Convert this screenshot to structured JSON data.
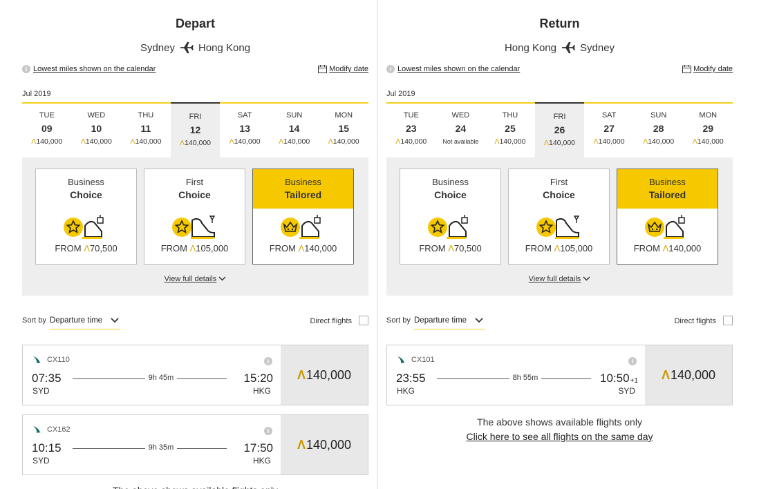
{
  "depart": {
    "title": "Depart",
    "from": "Sydney",
    "to": "Hong Kong",
    "lowest_miles_link": "Lowest miles shown on the calendar",
    "modify_date": "Modify date",
    "month": "Jul 2019",
    "dates": [
      {
        "dow": "TUE",
        "day": "09",
        "miles": "140,000"
      },
      {
        "dow": "WED",
        "day": "10",
        "miles": "140,000"
      },
      {
        "dow": "THU",
        "day": "11",
        "miles": "140,000"
      },
      {
        "dow": "FRI",
        "day": "12",
        "miles": "140,000",
        "selected": true
      },
      {
        "dow": "SAT",
        "day": "13",
        "miles": "140,000"
      },
      {
        "dow": "SUN",
        "day": "14",
        "miles": "140,000"
      },
      {
        "dow": "MON",
        "day": "15",
        "miles": "140,000"
      }
    ],
    "cabins": [
      {
        "name": "Business",
        "type": "Choice",
        "from_label": "FROM",
        "miles": "70,500",
        "icon": "star-seat-icon"
      },
      {
        "name": "First",
        "type": "Choice",
        "from_label": "FROM",
        "miles": "105,000",
        "icon": "star-first-seat-icon"
      },
      {
        "name": "Business",
        "type": "Tailored",
        "from_label": "FROM",
        "miles": "140,000",
        "icon": "crown-seat-icon",
        "selected": true
      }
    ],
    "view_details": "View full details",
    "sort_label": "Sort by",
    "sort_value": "Departure time",
    "direct_flights": "Direct flights",
    "flights": [
      {
        "code": "CX110",
        "dep_time": "07:35",
        "dep_ap": "SYD",
        "duration": "9h 45m",
        "arr_time": "15:20",
        "arr_suffix": "",
        "arr_ap": "HKG",
        "price": "140,000"
      },
      {
        "code": "CX162",
        "dep_time": "10:15",
        "dep_ap": "SYD",
        "duration": "9h 35m",
        "arr_time": "17:50",
        "arr_suffix": "",
        "arr_ap": "HKG",
        "price": "140,000"
      }
    ],
    "note": "The above shows available flights only"
  },
  "return": {
    "title": "Return",
    "from": "Hong Kong",
    "to": "Sydney",
    "lowest_miles_link": "Lowest miles shown on the calendar",
    "modify_date": "Modify date",
    "month": "Jul 2019",
    "dates": [
      {
        "dow": "TUE",
        "day": "23",
        "miles": "140,000"
      },
      {
        "dow": "WED",
        "day": "24",
        "miles": "Not available",
        "na": true
      },
      {
        "dow": "THU",
        "day": "25",
        "miles": "140,000"
      },
      {
        "dow": "FRI",
        "day": "26",
        "miles": "140,000",
        "selected": true
      },
      {
        "dow": "SAT",
        "day": "27",
        "miles": "140,000"
      },
      {
        "dow": "SUN",
        "day": "28",
        "miles": "140,000"
      },
      {
        "dow": "MON",
        "day": "29",
        "miles": "140,000"
      }
    ],
    "cabins": [
      {
        "name": "Business",
        "type": "Choice",
        "from_label": "FROM",
        "miles": "70,500",
        "icon": "star-seat-icon"
      },
      {
        "name": "First",
        "type": "Choice",
        "from_label": "FROM",
        "miles": "105,000",
        "icon": "star-first-seat-icon"
      },
      {
        "name": "Business",
        "type": "Tailored",
        "from_label": "FROM",
        "miles": "140,000",
        "icon": "crown-seat-icon",
        "selected": true
      }
    ],
    "view_details": "View full details",
    "sort_label": "Sort by",
    "sort_value": "Departure time",
    "direct_flights": "Direct flights",
    "flights": [
      {
        "code": "CX101",
        "dep_time": "23:55",
        "dep_ap": "HKG",
        "duration": "8h 55m",
        "arr_time": "10:50",
        "arr_suffix": "+1",
        "arr_ap": "SYD",
        "price": "140,000"
      }
    ],
    "note": "The above shows available flights only",
    "note_link": "Click here to see all flights on the same day"
  },
  "colors": {
    "accent": "#f5c800",
    "panel_bg": "#eeeeee",
    "price_bg": "#e8e8e8"
  }
}
